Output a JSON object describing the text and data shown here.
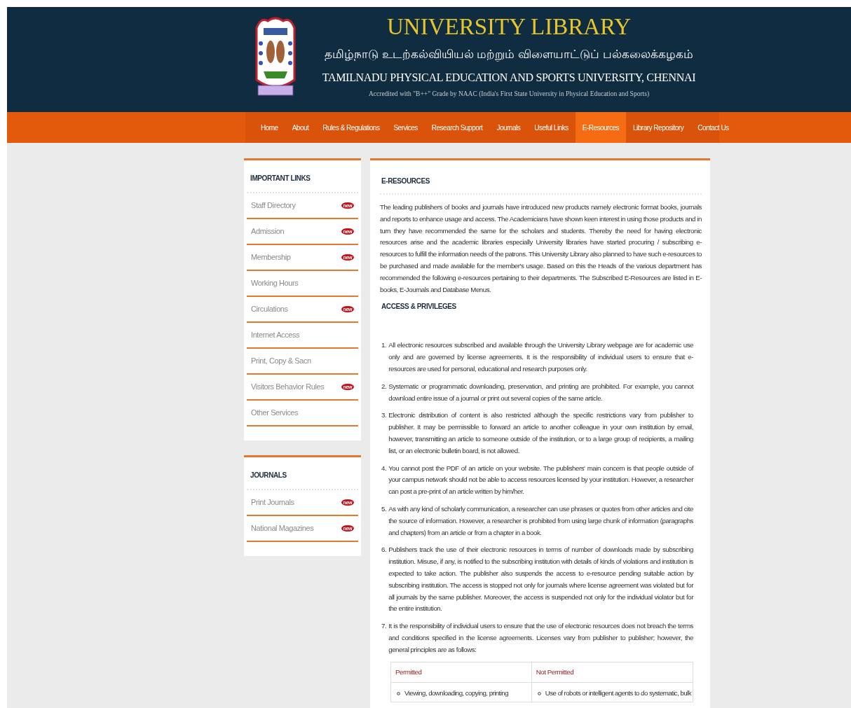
{
  "header": {
    "title": "UNIVERSITY LIBRARY",
    "tamil_name": "தமிழ்நாடு உடற்கல்வியியல் மற்றும் விளையாட்டுப் பல்கலைக்கழகம்",
    "english_name": "TAMILNADU PHYSICAL EDUCATION AND SPORTS UNIVERSITY, CHENNAI",
    "accreditation": "Accredited with \"B++\" Grade by NAAC (India's First State University in Physical Education and Sports)"
  },
  "nav": [
    {
      "label": "Home",
      "selected": false
    },
    {
      "label": "About",
      "selected": false
    },
    {
      "label": "Rules & Regulations",
      "selected": false
    },
    {
      "label": "Services",
      "selected": false
    },
    {
      "label": "Research Support",
      "selected": false
    },
    {
      "label": "Journals",
      "selected": false
    },
    {
      "label": "Useful Links",
      "selected": false
    },
    {
      "label": "E-Resources",
      "selected": true
    },
    {
      "label": "Library Repository",
      "selected": false
    },
    {
      "label": "Contact Us",
      "selected": false
    }
  ],
  "sidebar": [
    {
      "title": "IMPORTANT LINKS",
      "items": [
        {
          "label": "Staff Directory",
          "badge": "new"
        },
        {
          "label": "Admission",
          "badge": "new"
        },
        {
          "label": "Membership",
          "badge": "new"
        },
        {
          "label": "Working Hours"
        },
        {
          "label": "Circulations",
          "badge": "new"
        },
        {
          "label": "Internet Access"
        },
        {
          "label": "Print, Copy & Sacn"
        },
        {
          "label": "Visitors Behavior Rules",
          "badge": "new"
        },
        {
          "label": "Other Services"
        }
      ]
    },
    {
      "title": "JOURNALS",
      "items": [
        {
          "label": "Print Journals",
          "badge": "new"
        },
        {
          "label": "National Magazines",
          "badge": "new"
        }
      ]
    }
  ],
  "content": {
    "title": "E-RESOURCES",
    "intro": "The leading publishers of books and journals have introduced new products namely electronic format books, journals and reports to enhance usage and access. The Academicians have shown keen interest in using those products and in turn they have recommended the same for the scholars and students. Thereby the need for having electronic resources arise and the academic libraries especially University libraries have started procuring / subscribing e-resources to fulfill the information needs of the patrons. This University Library also planned to have such e-resources to be purchased and made available for the member's usage. Based on this the Heads of the various department has recommended the following e-resources pertaining to their departments. The Subscribed E-Resources are listed in E-books, E-Journals and Database Menus.",
    "subtitle": "ACCESS & PRIVILEGES",
    "rules": [
      {
        "number": "1.",
        "text": "All electronic resources subscribed and available through the University Library webpage are for academic use only and are governed by license agreements. It is the responsibility of individual users to ensure that e-resources are used for personal, educational and research purposes only."
      },
      {
        "number": "2.",
        "text": "Systematic or programmatic downloading, preservation, and printing are prohibited. For example, you cannot download entire issue of a journal or print out several copies of the same article."
      },
      {
        "number": "3.",
        "text": "Electronic distribution of content is also restricted although the specific restrictions vary from publisher to publisher. It may be permissible to forward an article to another colleague in your own institution by email, however, transmitting an article to someone outside of the institution, or to a large group of recipients, a mailing list, or an electronic bulletin board, is not allowed."
      },
      {
        "number": "4.",
        "text": "You cannot post the PDF of an article on your website. The publishers' main concern is that people outside of your campus network should not be able to access resources licensed by your institution. However, a researcher can post a pre-print of an article written by him/her."
      },
      {
        "number": "5.",
        "text": "As with any kind of scholarly communication, a researcher can use phrases or quotes from other articles and cite the source of information. However, a researcher is prohibited from using large chunk of information (paragraphs and chapters) from an article or from a chapter in a book."
      },
      {
        "number": "6.",
        "text": "Publishers track the use of their electronic resources in terms of number of downloads made by subscribing institution. Misuse, if any, is notified to the subscribing institution with details of kinds of violations and institution is expected to take action. The publisher also suspends the access to e-resource pending suitable action by subscribing institution. The access is stopped not only for journals where license agreement was violated but for all journals by the same publisher. Moreover, the access is suspended not only for the individual violator but for the entire institution."
      },
      {
        "number": "7.",
        "text": "It is the responsibility of individual users to ensure that the use of electronic resources does not breach the terms and conditions specified in the license agreements. Licenses vary from publisher to publisher; however, the general principles are as follows:"
      }
    ],
    "table": {
      "columns": [
        "Permitted",
        "Not Permitted"
      ],
      "rows": [
        [
          "Viewing, downloading, copying, printing",
          "Use of robots or intelligent agents to do systematic, bulk"
        ]
      ]
    }
  }
}
